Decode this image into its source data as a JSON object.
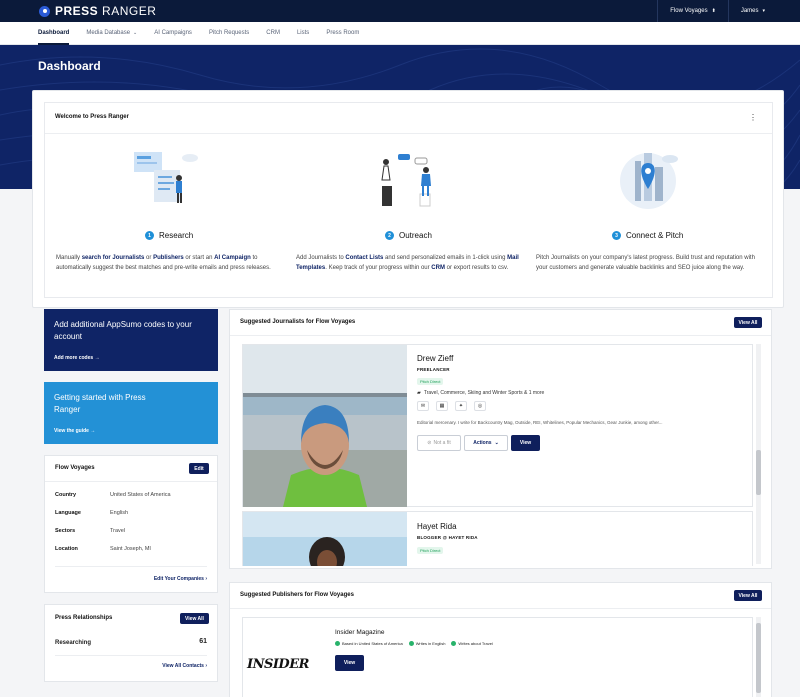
{
  "brand": {
    "bold": "PRESS",
    "light": " RANGER"
  },
  "topbar": {
    "company": "Flow Voyages",
    "user": "James"
  },
  "nav": [
    "Dashboard",
    "Media Database",
    "AI Campaigns",
    "Pitch Requests",
    "CRM",
    "Lists",
    "Press Room"
  ],
  "page_title": "Dashboard",
  "welcome": {
    "title": "Welcome to Press Ranger",
    "steps": [
      {
        "num": "1",
        "title": "Research",
        "desc_parts": [
          "Manually ",
          "search for Journalists",
          " or ",
          "Publishers",
          " or start an ",
          "AI Campaign",
          " to automatically suggest the best matches and pre-write emails and press releases."
        ]
      },
      {
        "num": "2",
        "title": "Outreach",
        "desc_parts": [
          "Add Journalists to ",
          "Contact Lists",
          " and send personalized emails in 1-click using ",
          "Mail Templates",
          ". Keep track of your progress within our ",
          "CRM",
          " or export results to csv."
        ]
      },
      {
        "num": "3",
        "title": "Connect & Pitch",
        "desc_parts": [
          "Pitch Journalists on your company's latest progress. Build trust and reputation with your customers and generate valuable backlinks and SEO juice along the way."
        ]
      }
    ]
  },
  "appsumo": {
    "title": "Add additional AppSumo codes to your account",
    "link": "Add more codes →"
  },
  "getting_started": {
    "title": "Getting started with Press Ranger",
    "link": "View the guide →"
  },
  "company": {
    "name": "Flow Voyages",
    "edit": "Edit",
    "rows": [
      {
        "k": "Country",
        "v": "United States of America"
      },
      {
        "k": "Language",
        "v": "English"
      },
      {
        "k": "Sectors",
        "v": "Travel"
      },
      {
        "k": "Location",
        "v": "Saint Joseph, MI"
      }
    ],
    "link": "Edit Your Companies ›"
  },
  "relationships": {
    "title": "Press Relationships",
    "view_all": "View All",
    "label": "Researching",
    "count": "61",
    "link": "View All Contacts ›"
  },
  "journalists": {
    "title": "Suggested Journalists for Flow Voyages",
    "view_all": "View All",
    "items": [
      {
        "name": "Drew Zieff",
        "role": "FREELANCER",
        "badge": "Pitch Direct",
        "topics": "Travel, Commerce, Skiing and Winter Sports & 1 more",
        "bio": "Editorial mercenary. I write for Backcountry Mag, Outside, REI, Whitelines, Popular Mechanics, Gear Junkie, among other...",
        "not_fit": "Not a fit",
        "actions": "Actions",
        "view": "View"
      },
      {
        "name": "Hayet Rida",
        "role": "BLOGGER @ HAYET RIDA",
        "badge": "Pitch Direct"
      }
    ]
  },
  "publishers": {
    "title": "Suggested Publishers for Flow Voyages",
    "view_all": "View All",
    "items": [
      {
        "name": "Insider Magazine",
        "logo": "INSIDER",
        "badges": [
          "Based in United States of America",
          "Writes in English",
          "Writes about Travel"
        ],
        "view": "View"
      }
    ]
  }
}
